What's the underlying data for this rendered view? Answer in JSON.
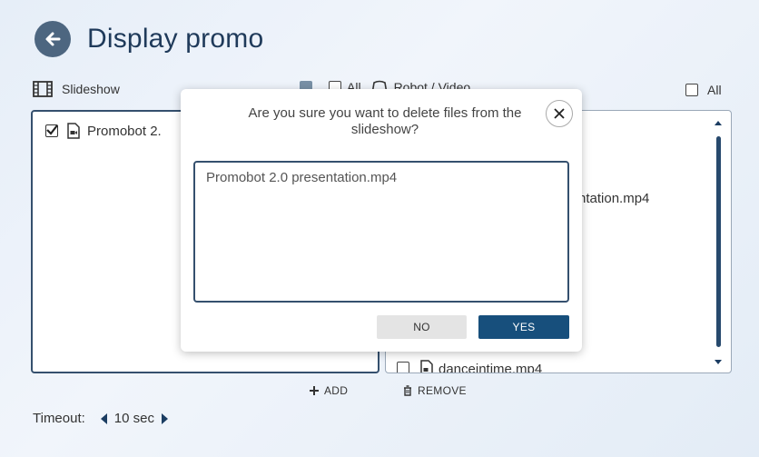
{
  "header": {
    "title": "Display promo",
    "back_icon": "arrow-left-icon"
  },
  "slideshow": {
    "title": "Slideshow",
    "all_label": "All",
    "items": [
      {
        "name": "Promobot 2.",
        "checked": true
      }
    ]
  },
  "robot_video": {
    "title": "Robot / Video",
    "all_label": "All",
    "items": [
      {
        "name": "ntation.mp4"
      },
      {
        "name": "danceintime.mp4"
      }
    ]
  },
  "actions": {
    "add_label": "ADD",
    "remove_label": "REMOVE"
  },
  "timeout": {
    "label": "Timeout:",
    "value": "10 sec"
  },
  "dialog": {
    "message": "Are you sure you want to delete files from the slideshow?",
    "files": [
      "Promobot 2.0 presentation.mp4"
    ],
    "no_label": "NO",
    "yes_label": "YES"
  },
  "colors": {
    "accent": "#174f7c",
    "title": "#1f3a5a",
    "border": "#35506e"
  }
}
